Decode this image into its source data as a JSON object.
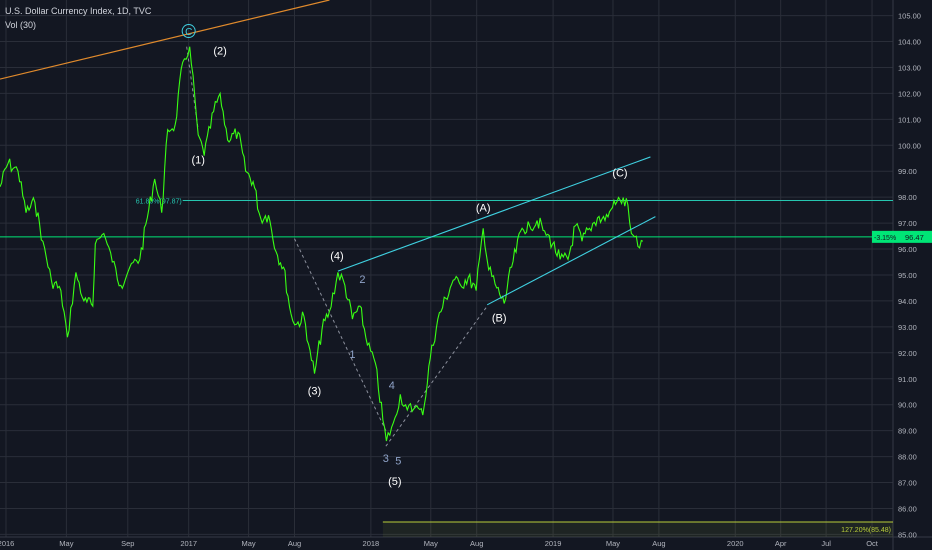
{
  "header": {
    "title": "U.S. Dollar Currency Index, 1D, TVC",
    "volume": "Vol (30)"
  },
  "colors": {
    "background": "#131722",
    "grid": "#2a2e39",
    "price": "#39ff14",
    "channel": "#3fd0e0",
    "resistance": "#e08a2c",
    "horizontal": "#26c6b0",
    "current": "#00e676",
    "fib_bottom": "#b9ce3a",
    "dotted": "#8b8f9c"
  },
  "chart_data": {
    "type": "line",
    "title": "U.S. Dollar Currency Index, 1D, TVC",
    "ylim": [
      84.9,
      105.6
    ],
    "y_ticks": [
      "105.00",
      "104.00",
      "103.00",
      "102.00",
      "101.00",
      "100.00",
      "99.00",
      "98.00",
      "97.00",
      "96.00",
      "95.00",
      "94.00",
      "93.00",
      "92.00",
      "91.00",
      "90.00",
      "89.00",
      "88.00",
      "87.00",
      "86.00",
      "85.00"
    ],
    "x_ticks": [
      "2016",
      "May",
      "Sep",
      "2017",
      "May",
      "Aug",
      "2018",
      "May",
      "Aug",
      "2019",
      "May",
      "Aug",
      "2020",
      "Apr",
      "Jul",
      "Oct"
    ],
    "x_tick_dates": [
      "2016-01-01",
      "2016-05-01",
      "2016-09-01",
      "2017-01-01",
      "2017-05-01",
      "2017-08-01",
      "2018-01-01",
      "2018-05-01",
      "2018-08-01",
      "2019-01-01",
      "2019-05-01",
      "2019-08-01",
      "2020-01-01",
      "2020-04-01",
      "2020-07-01",
      "2020-10-01"
    ],
    "xlim": [
      "2015-12-20",
      "2020-11-12"
    ],
    "grid": true,
    "series": [
      {
        "dates": [
          "2015-12-20",
          "2016-01-05",
          "2016-01-25",
          "2016-02-10",
          "2016-02-28",
          "2016-03-15",
          "2016-04-01",
          "2016-04-20",
          "2016-05-03",
          "2016-05-20",
          "2016-06-05",
          "2016-06-23",
          "2016-06-28",
          "2016-07-15",
          "2016-08-01",
          "2016-08-18",
          "2016-09-05",
          "2016-09-25",
          "2016-10-10",
          "2016-10-25",
          "2016-11-08",
          "2016-11-20",
          "2016-12-05",
          "2016-12-20",
          "2017-01-03",
          "2017-01-20",
          "2017-02-01",
          "2017-02-20",
          "2017-03-05",
          "2017-03-20",
          "2017-04-10",
          "2017-04-25",
          "2017-05-10",
          "2017-05-25",
          "2017-06-10",
          "2017-06-25",
          "2017-07-10",
          "2017-07-25",
          "2017-08-05",
          "2017-08-20",
          "2017-09-01",
          "2017-09-10",
          "2017-09-25",
          "2017-10-10",
          "2017-10-27",
          "2017-11-10",
          "2017-11-25",
          "2017-12-10",
          "2017-12-25",
          "2018-01-10",
          "2018-01-25",
          "2018-02-01",
          "2018-02-15",
          "2018-03-01",
          "2018-03-15",
          "2018-03-31",
          "2018-04-15",
          "2018-04-30",
          "2018-05-15",
          "2018-05-31",
          "2018-06-15",
          "2018-06-30",
          "2018-07-15",
          "2018-07-31",
          "2018-08-14",
          "2018-08-25",
          "2018-09-10",
          "2018-09-25",
          "2018-10-10",
          "2018-10-31",
          "2018-11-15",
          "2018-11-30",
          "2018-12-15",
          "2018-12-31",
          "2019-01-15",
          "2019-01-31",
          "2019-02-15",
          "2019-02-28",
          "2019-03-15",
          "2019-03-31",
          "2019-04-15",
          "2019-04-30",
          "2019-05-15",
          "2019-05-31",
          "2019-06-07",
          "2019-06-20",
          "2019-06-30"
        ],
        "values": [
          98.4,
          99.3,
          99.0,
          97.4,
          97.8,
          96.3,
          94.8,
          94.4,
          92.6,
          95.1,
          94.0,
          93.8,
          96.2,
          96.6,
          95.5,
          94.6,
          95.3,
          95.6,
          97.2,
          98.7,
          97.4,
          100.6,
          100.8,
          103.2,
          103.8,
          100.4,
          99.6,
          101.3,
          102.0,
          100.2,
          100.5,
          99.0,
          98.6,
          97.2,
          97.3,
          95.9,
          95.3,
          93.5,
          93.1,
          93.4,
          92.1,
          91.2,
          92.9,
          93.6,
          95.1,
          94.6,
          93.3,
          93.8,
          92.3,
          91.6,
          89.4,
          88.6,
          89.3,
          90.4,
          89.8,
          89.9,
          89.6,
          91.8,
          93.3,
          94.1,
          94.8,
          94.6,
          94.9,
          94.4,
          96.8,
          95.2,
          94.5,
          93.9,
          95.3,
          96.8,
          96.9,
          97.1,
          96.7,
          96.2,
          95.6,
          95.6,
          96.9,
          96.3,
          96.8,
          97.2,
          97.1,
          97.6,
          97.9,
          97.7,
          96.6,
          96.1,
          96.3
        ]
      }
    ],
    "current_price": {
      "value": 96.47,
      "change": "-3.15%",
      "label": "96.47"
    },
    "fib_levels": [
      {
        "value": 97.87,
        "label": "61.80%(97.87)"
      },
      {
        "value": 85.48,
        "label": "127.20%(85.48)"
      }
    ],
    "wave_labels": [
      {
        "text": "C",
        "date": "2017-01-01",
        "value": 104.25,
        "style": "circled"
      },
      {
        "text": "(2)",
        "date": "2017-03-05",
        "value": 103.5,
        "style": "major"
      },
      {
        "text": "(1)",
        "date": "2017-01-20",
        "value": 99.3,
        "style": "major"
      },
      {
        "text": "(3)",
        "date": "2017-09-10",
        "value": 90.4,
        "style": "major"
      },
      {
        "text": "(4)",
        "date": "2017-10-25",
        "value": 95.6,
        "style": "major"
      },
      {
        "text": "1",
        "date": "2017-11-25",
        "value": 91.8,
        "style": "minor"
      },
      {
        "text": "2",
        "date": "2017-12-15",
        "value": 94.7,
        "style": "minor"
      },
      {
        "text": "3",
        "date": "2018-01-31",
        "value": 87.8,
        "style": "minor"
      },
      {
        "text": "4",
        "date": "2018-02-12",
        "value": 90.6,
        "style": "minor"
      },
      {
        "text": "5",
        "date": "2018-02-25",
        "value": 87.7,
        "style": "minor"
      },
      {
        "text": "(5)",
        "date": "2018-02-18",
        "value": 86.9,
        "style": "major"
      },
      {
        "text": "(A)",
        "date": "2018-08-14",
        "value": 97.45,
        "style": "major"
      },
      {
        "text": "(B)",
        "date": "2018-09-15",
        "value": 93.2,
        "style": "major"
      },
      {
        "text": "(C)",
        "date": "2019-05-15",
        "value": 98.8,
        "style": "major"
      }
    ]
  }
}
